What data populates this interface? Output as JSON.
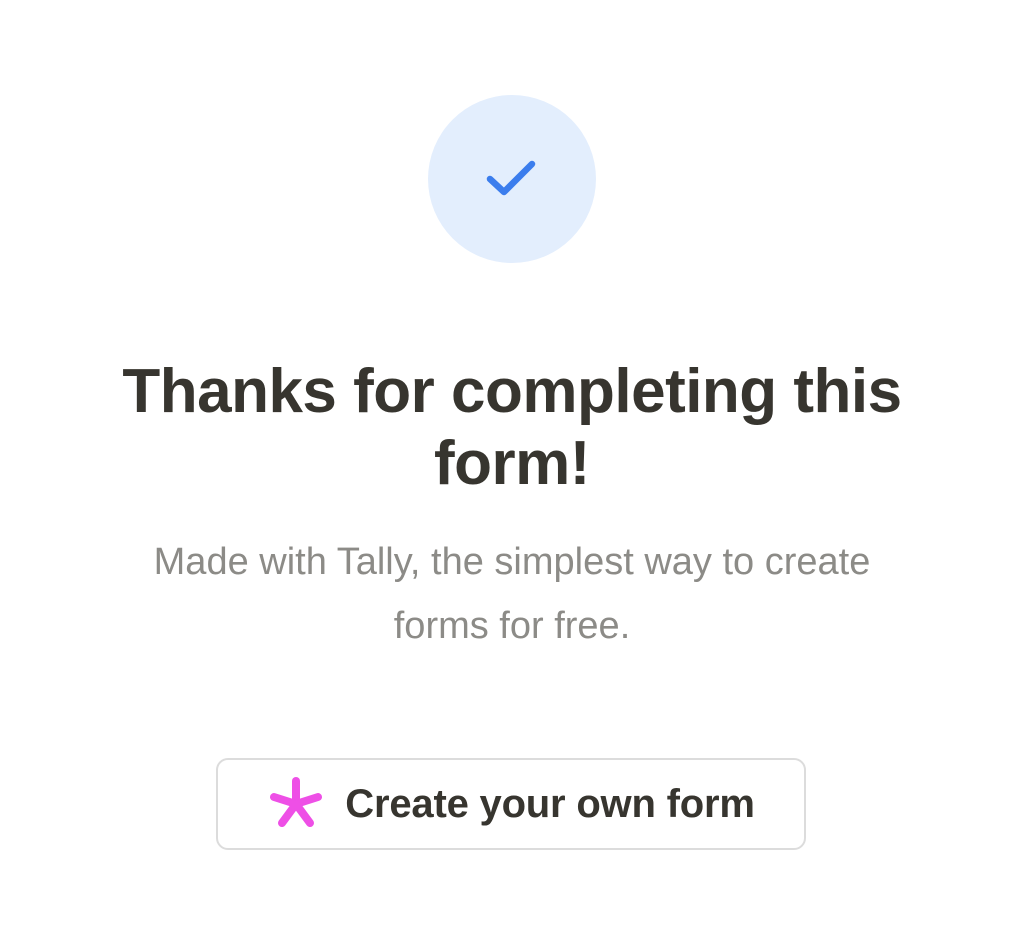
{
  "confirmation": {
    "icon": "check-icon",
    "title": "Thanks for completing this form!",
    "subtitle": "Made with Tally, the simplest way to create forms for free.",
    "colors": {
      "icon_bg": "#e3eefd",
      "icon_check": "#3b7ded",
      "title": "#37352f",
      "subtitle": "#8c8b87"
    }
  },
  "cta": {
    "label": "Create your own form",
    "icon": "asterisk-icon",
    "colors": {
      "icon": "#ee4fe6",
      "border": "#dcdcdc",
      "text": "#37352f"
    }
  }
}
